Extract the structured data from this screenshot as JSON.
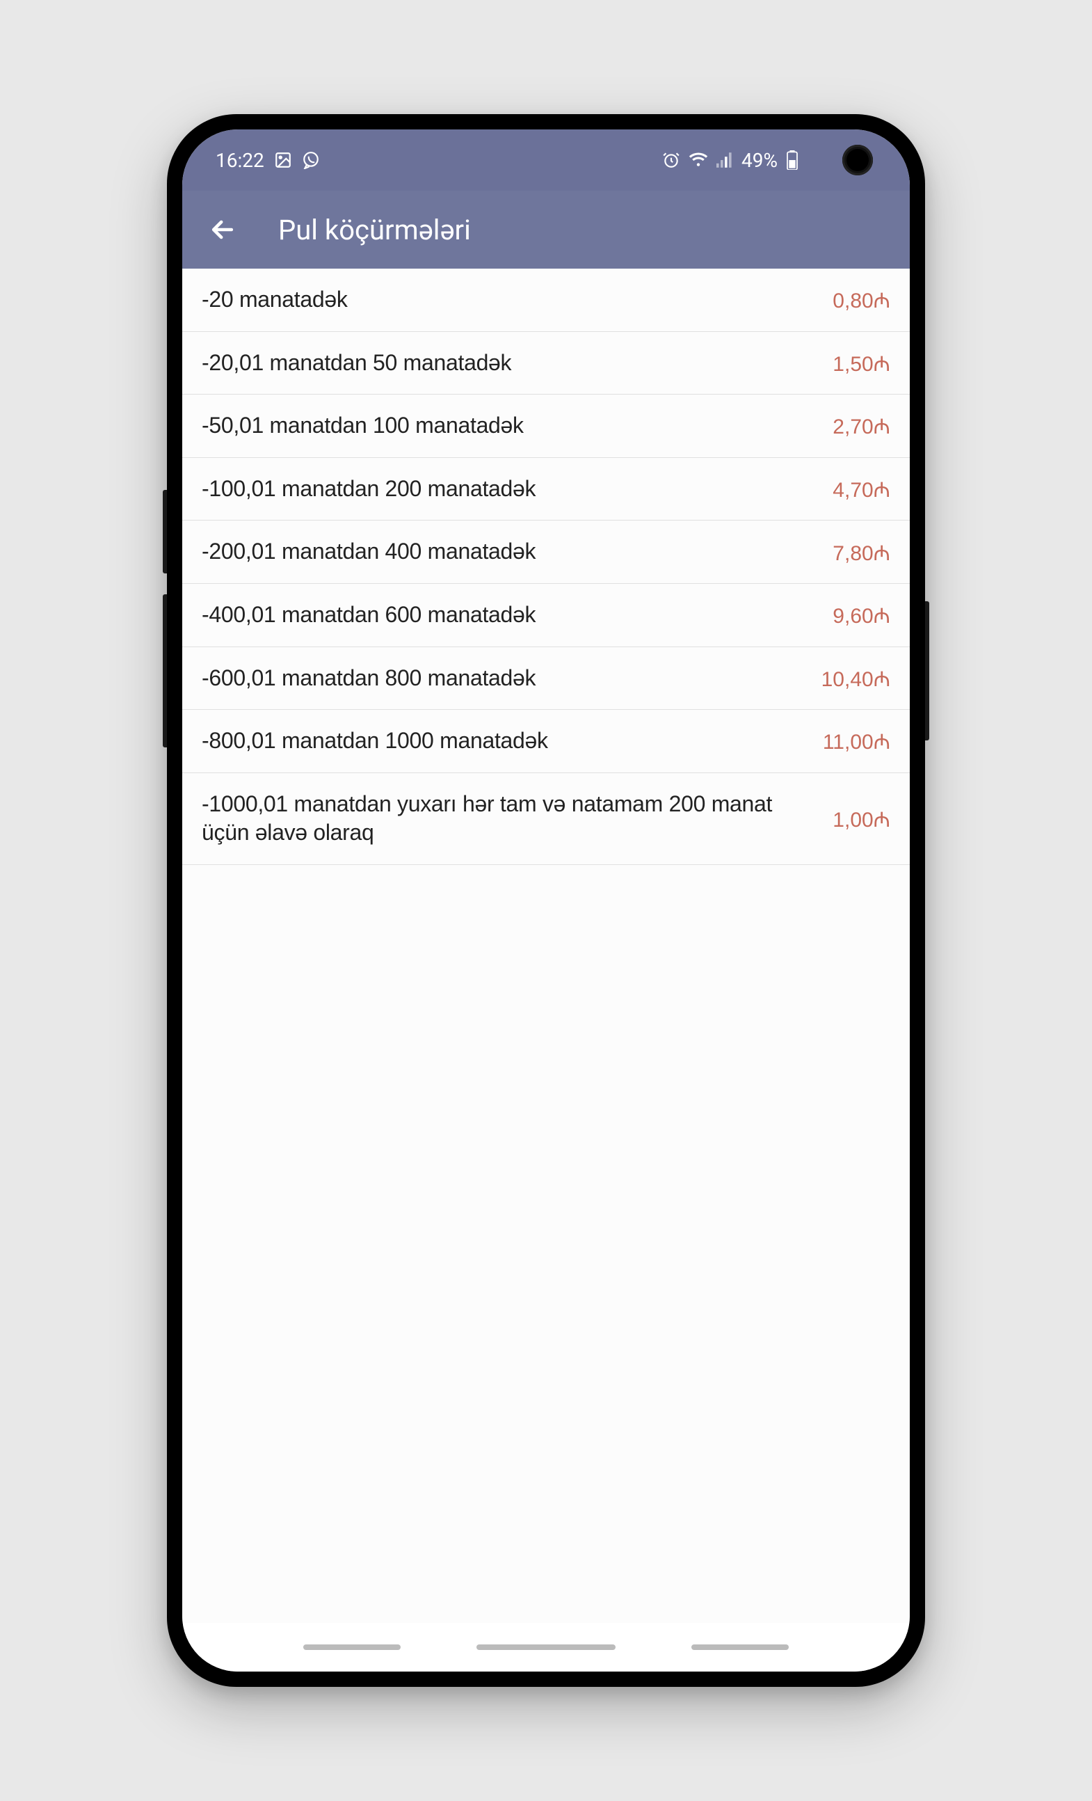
{
  "status": {
    "time": "16:22",
    "battery": "49%"
  },
  "header": {
    "title": "Pul köçürmələri"
  },
  "currency_symbol": "₼",
  "rows": [
    {
      "label": "-20 manatadək",
      "price": "0,80₼"
    },
    {
      "label": "-20,01 manatdan 50 manatadək",
      "price": "1,50₼"
    },
    {
      "label": "-50,01 manatdan 100 manatadək",
      "price": "2,70₼"
    },
    {
      "label": "-100,01 manatdan 200 manatadək",
      "price": "4,70₼"
    },
    {
      "label": "-200,01 manatdan 400 manatadək",
      "price": "7,80₼"
    },
    {
      "label": "-400,01 manatdan 600 manatadək",
      "price": "9,60₼"
    },
    {
      "label": "-600,01 manatdan 800 manatadək",
      "price": "10,40₼"
    },
    {
      "label": "-800,01 manatdan 1000 manatadək",
      "price": "11,00₼"
    },
    {
      "label": "-1000,01 manatdan yuxarı hər tam və natamam 200 manat üçün əlavə olaraq",
      "price": "1,00₼"
    }
  ]
}
